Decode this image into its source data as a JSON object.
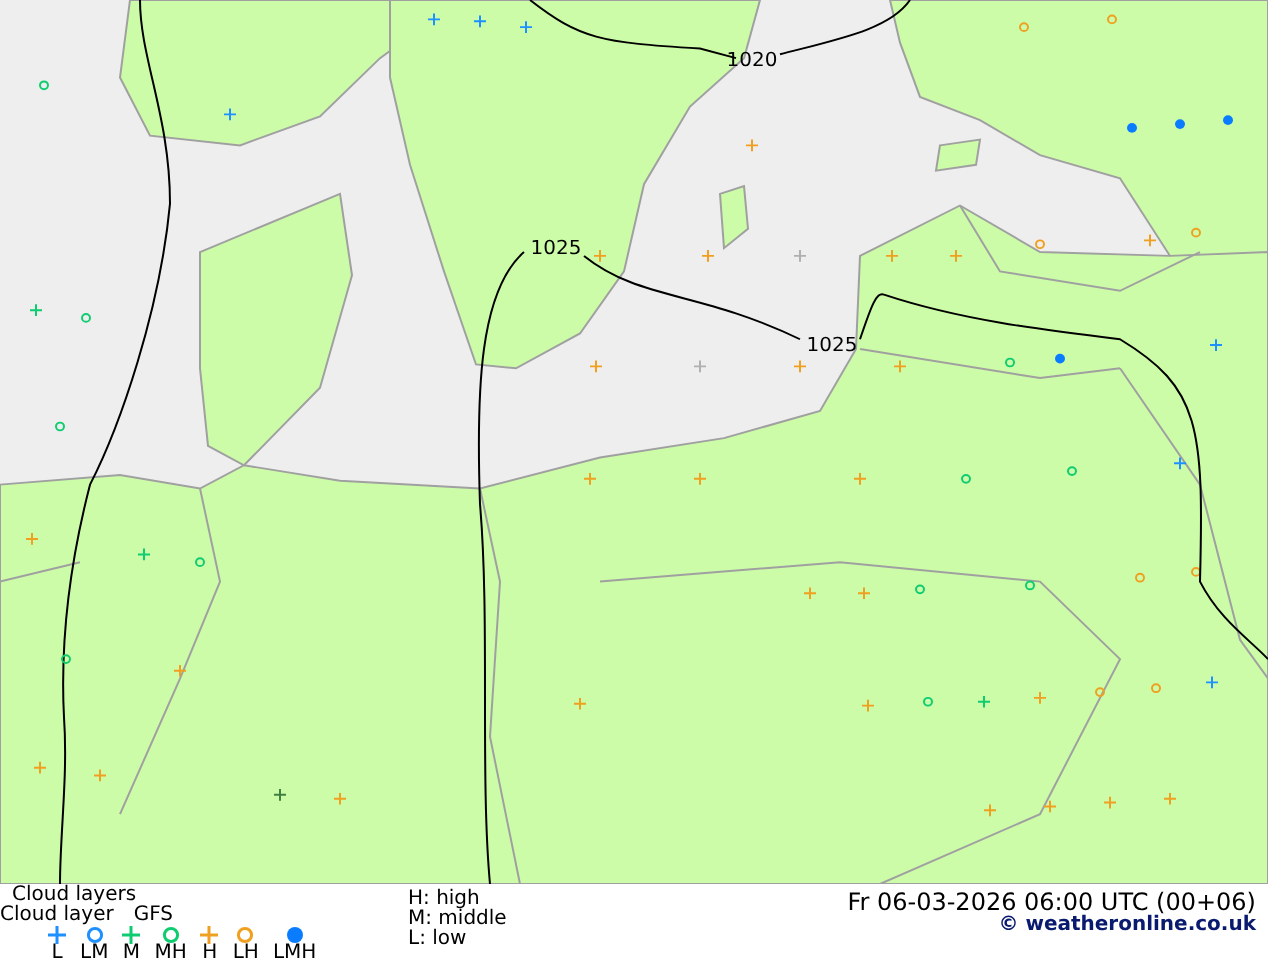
{
  "map": {
    "isobars": [
      {
        "label": "1020"
      },
      {
        "label": "1025"
      },
      {
        "label": "1025"
      }
    ]
  },
  "footer": {
    "title": "Cloud layers",
    "subtitle": "Cloud layer",
    "model": "GFS",
    "legend": [
      {
        "kind": "plus",
        "color": "#1e90ff",
        "label": "L"
      },
      {
        "kind": "ring",
        "color": "#1e90ff",
        "label": "LM"
      },
      {
        "kind": "plus",
        "color": "#10cc70",
        "label": "M"
      },
      {
        "kind": "ring",
        "color": "#10cc70",
        "label": "MH"
      },
      {
        "kind": "plus",
        "color": "#f0a020",
        "label": "H"
      },
      {
        "kind": "ring",
        "color": "#f0a020",
        "label": "LH"
      },
      {
        "kind": "dot",
        "color": "#0a7cff",
        "label": "LMH"
      }
    ],
    "key": [
      "H: high",
      "M: middle",
      "L: low"
    ],
    "datetime": "Fr 06-03-2026 06:00 UTC (00+06)",
    "copyright": "© weatheronline.co.uk"
  }
}
